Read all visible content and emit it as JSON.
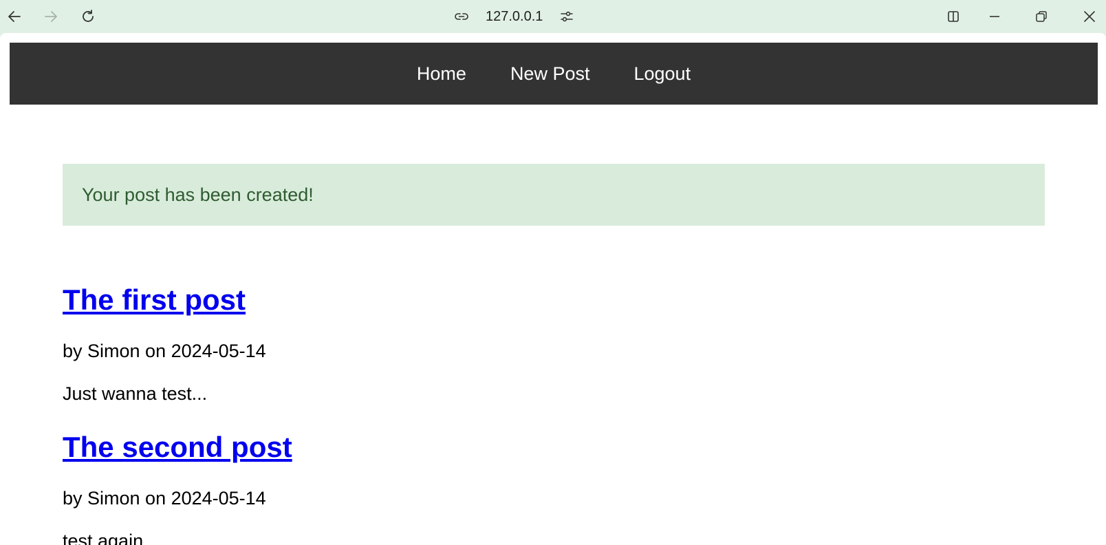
{
  "browser": {
    "url": "127.0.0.1",
    "icons": {
      "back": "arrow-left-icon",
      "forward": "arrow-right-icon",
      "reload": "reload-icon",
      "site_info": "link-icon",
      "site_settings": "sliders-icon",
      "split": "split-view-icon",
      "minimize": "minimize-icon",
      "restore": "restore-icon",
      "close": "close-icon"
    }
  },
  "nav": {
    "items": [
      {
        "label": "Home"
      },
      {
        "label": "New Post"
      },
      {
        "label": "Logout"
      }
    ]
  },
  "alert": {
    "message": "Your post has been created!"
  },
  "posts": [
    {
      "title": "The first post",
      "meta": "by Simon on 2024-05-14",
      "excerpt": "Just wanna test..."
    },
    {
      "title": "The second post",
      "meta": "by Simon on 2024-05-14",
      "excerpt": "test again..."
    }
  ],
  "colors": {
    "chrome_bg": "#e1f0e4",
    "navbar_bg": "#333333",
    "alert_bg": "#d9ecdb",
    "alert_text": "#2f5b31",
    "link": "#0000ee"
  }
}
